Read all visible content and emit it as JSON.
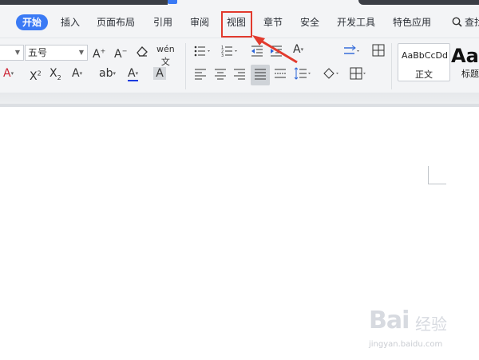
{
  "menu": {
    "items": [
      "开始",
      "插入",
      "页面布局",
      "引用",
      "审阅",
      "视图",
      "章节",
      "安全",
      "开发工具",
      "特色应用"
    ],
    "search_label": "查找"
  },
  "ribbon": {
    "font_name": "",
    "font_size": "五号",
    "styles": [
      {
        "sample": "AaBbCcDd",
        "label": "正文"
      },
      {
        "sample": "AaI",
        "label": "标题"
      }
    ]
  },
  "annotation": {
    "highlight_color": "#e23a2d",
    "target": "视图"
  },
  "watermark": {
    "brand": "Bai",
    "brand2": "经验",
    "url": "jingyan.baidu.com"
  },
  "colors": {
    "accent": "#3a7af5",
    "annotation": "#e23a2d",
    "ribbon_bg": "#f3f4f6"
  }
}
